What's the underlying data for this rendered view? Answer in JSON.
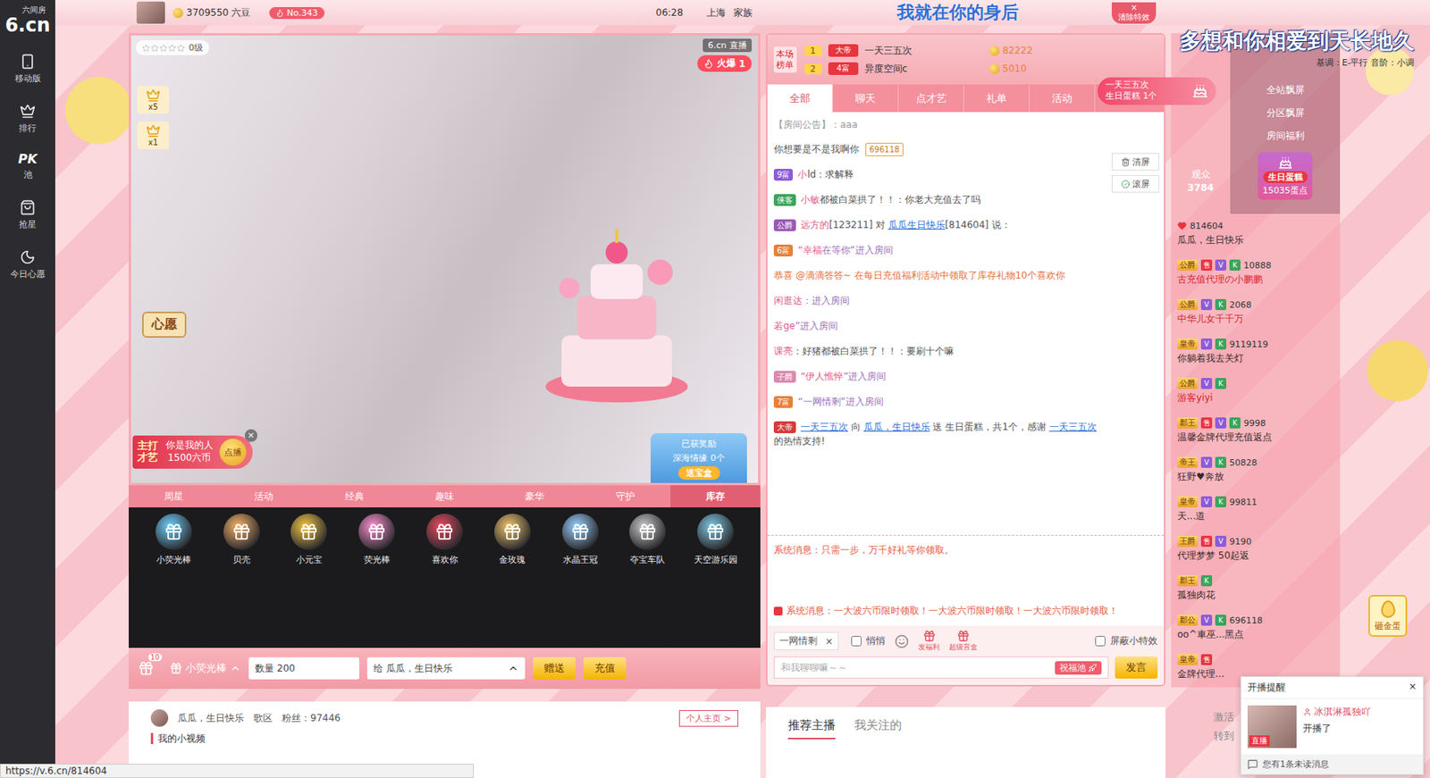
{
  "logo": {
    "mark": "6.cn",
    "name": "六间房"
  },
  "sidebar": [
    {
      "label": "移动版",
      "kind": "icon"
    },
    {
      "label": "排行",
      "kind": "icon"
    },
    {
      "label": "池",
      "mark": "PK",
      "kind": "mark"
    },
    {
      "label": "抢星",
      "kind": "icon"
    },
    {
      "label": "今日心愿",
      "kind": "icon"
    }
  ],
  "topbar": {
    "beans": "3709550 六豆",
    "rank": "No.343",
    "time": "06:28",
    "city": "上海",
    "family": "家族",
    "marquee": "我就在你的身后",
    "clear": "清除特效",
    "clearIcon": "×"
  },
  "banner": {
    "title": "多想和你相爱到天长地久",
    "sub": "基调：E-平行  音阶：小调"
  },
  "video": {
    "stars": 0,
    "level": "0级",
    "badges": [
      {
        "count": "x5"
      },
      {
        "count": "x1"
      }
    ],
    "brand": "6.cn",
    "live": "直播",
    "hot": "火爆",
    "hotCount": "1",
    "wish": "心愿",
    "song": {
      "tag": "主打才艺",
      "title": "你是我的人",
      "price": "1500六币",
      "button": "点播",
      "close": "×"
    },
    "activity": [
      "已获奖励",
      "深海情缘 0个",
      "送宝盒"
    ]
  },
  "giftTabs": [
    {
      "label": "周星",
      "selected": false
    },
    {
      "label": "活动",
      "selected": false
    },
    {
      "label": "经典",
      "selected": false
    },
    {
      "label": "趣味",
      "selected": false
    },
    {
      "label": "豪华",
      "selected": false
    },
    {
      "label": "守护",
      "selected": false
    },
    {
      "label": "库存",
      "selected": true
    }
  ],
  "gifts": [
    "小荧光棒",
    "贝壳",
    "小元宝",
    "荧光棒",
    "喜欢你",
    "金玫瑰",
    "水晶王冠",
    "夺宝车队",
    "天空游乐园"
  ],
  "sendBar": {
    "count": "10",
    "gift": "小荧光棒",
    "qty": "数量 200",
    "to": "给 瓜瓜，生日快乐",
    "send": "赠送",
    "recharge": "充值"
  },
  "profile": {
    "name": "瓜瓜，生日快乐",
    "zone": "歌区",
    "fans": "粉丝：97446",
    "home": "个人主页 >",
    "videos": "我的小视频"
  },
  "rank": {
    "label": "本场榜单",
    "rows": [
      {
        "rank": "1",
        "badge": "大帝",
        "name": "一天三五次",
        "score": "82222"
      },
      {
        "rank": "2",
        "badge": "4富",
        "name": "异度空间c",
        "score": "5010"
      }
    ]
  },
  "chatTabs": [
    {
      "label": "全部",
      "selected": true
    },
    {
      "label": "聊天",
      "selected": false
    },
    {
      "label": "点才艺",
      "selected": false
    },
    {
      "label": "礼单",
      "selected": false
    },
    {
      "label": "活动",
      "selected": false
    }
  ],
  "chatTools": [
    "清屏",
    "滚屏"
  ],
  "announcement": "【房间公告】：aaa",
  "messages": [
    {
      "badge": "",
      "color": "#999999",
      "tag": "696118",
      "parts": [
        {
          "text": "你想要是不是我啊你",
          "tone": "plain"
        }
      ]
    },
    {
      "badge": "9富",
      "color": "#8e5bd8",
      "tag": "",
      "parts": [
        {
          "text": "小",
          "tone": "user"
        },
        {
          "text": "ld：求解释",
          "tone": "plain"
        }
      ]
    },
    {
      "badge": "侠客",
      "color": "#3aa55a",
      "tag": "",
      "parts": [
        {
          "text": "小敏",
          "tone": "user"
        },
        {
          "text": "都被白菜拱了！！：你老大充值去了吗",
          "tone": "plain"
        }
      ]
    },
    {
      "badge": "公爵",
      "color": "#9b59b6",
      "tag": "",
      "parts": [
        {
          "text": "远方的",
          "tone": "user"
        },
        {
          "text": "[123211] 对 ",
          "tone": "plain"
        },
        {
          "text": "瓜瓜生日快乐",
          "tone": "link"
        },
        {
          "text": "[814604] 说：",
          "tone": "plain"
        }
      ]
    },
    {
      "badge": "6富",
      "color": "#e8803a",
      "tag": "",
      "parts": [
        {
          "text": "“幸福",
          "tone": "user"
        },
        {
          "text": "在等你”进入房间",
          "tone": "enter"
        }
      ]
    },
    {
      "badge": "",
      "color": "#999999",
      "tag": "",
      "parts": [
        {
          "text": "恭喜 @滴滴答答~ 在每日充值福利活动中领取了库存礼物10个喜欢你",
          "tone": "notice"
        }
      ]
    },
    {
      "badge": "",
      "color": "#999999",
      "tag": "",
      "parts": [
        {
          "text": "闲逛达",
          "tone": "user"
        },
        {
          "text": "：进入房间",
          "tone": "enter"
        }
      ]
    },
    {
      "badge": "",
      "color": "#999999",
      "tag": "",
      "parts": [
        {
          "text": "若ge",
          "tone": "user"
        },
        {
          "text": "”进入房间",
          "tone": "enter"
        }
      ]
    },
    {
      "badge": "",
      "color": "#999999",
      "tag": "",
      "parts": [
        {
          "text": "课亮",
          "tone": "user"
        },
        {
          "text": "：好猪都被白菜拱了！！：要刷十个嘛",
          "tone": "plain"
        }
      ]
    },
    {
      "badge": "子爵",
      "color": "#d98ab0",
      "tag": "",
      "parts": [
        {
          "text": "“伊人憔悴",
          "tone": "user"
        },
        {
          "text": "”进入房间",
          "tone": "enter"
        }
      ]
    },
    {
      "badge": "7富",
      "color": "#e8803a",
      "tag": "",
      "parts": [
        {
          "text": "“一网情剩”进入房间",
          "tone": "enter"
        }
      ]
    },
    {
      "badge": "大帝",
      "color": "#d63a3a",
      "tag": "",
      "parts": [
        {
          "text": "一天三五次",
          "tone": "link"
        },
        {
          "text": " 向 ",
          "tone": "plain"
        },
        {
          "text": "瓜瓜，生日快乐",
          "tone": "link"
        },
        {
          "text": " 送 生日蛋糕，共1个，感谢 ",
          "tone": "plain"
        },
        {
          "text": "一天三五次",
          "tone": "link"
        },
        {
          "text": " 的热情支持!",
          "tone": "plain"
        }
      ]
    }
  ],
  "systemMessages": [
    "系统消息：只需一步，万千好礼等你领取。",
    "系统消息：一大波六币限时领取！一大波六币限时领取！一大波六币限时领取！"
  ],
  "input": {
    "target": "一网情剩",
    "targetClose": "×",
    "whisper": {
      "label": "悄悄",
      "checked": false
    },
    "tools": [
      "发福利",
      "超级盲盒"
    ],
    "mute": {
      "label": "屏蔽小特效",
      "checked": false
    },
    "placeholder": "和我聊聊嘛～～",
    "wish": "祝福池",
    "send": "发言"
  },
  "audience": {
    "label": "观众",
    "count": "3784",
    "users": [
      {
        "role": "",
        "marks": [],
        "id": "814604",
        "name": "瓜瓜，生日快乐",
        "color": "#3a2a2a"
      },
      {
        "role": "公爵",
        "marks": [
          "售",
          "V",
          "K"
        ],
        "id": "10888",
        "name": "古充值代理の小鹏鹏",
        "color": "#d8232a"
      },
      {
        "role": "公爵",
        "marks": [
          "V",
          "K"
        ],
        "id": "2068",
        "name": "中华儿女千千万",
        "color": "#d8232a"
      },
      {
        "role": "皇帝",
        "marks": [
          "V",
          "K"
        ],
        "id": "9119119",
        "name": "你躺着我去关灯",
        "color": "#3a2a2a"
      },
      {
        "role": "公爵",
        "marks": [
          "V",
          "K"
        ],
        "id": "",
        "name": "游客yiyi",
        "color": "#d8232a"
      },
      {
        "role": "郡王",
        "marks": [
          "售",
          "V",
          "K"
        ],
        "id": "9998",
        "name": "温馨金牌代理充值返点",
        "color": "#3a2a2a"
      },
      {
        "role": "帝王",
        "marks": [
          "V",
          "K"
        ],
        "id": "50828",
        "name": "狂野♥奔放",
        "color": "#3a2a2a"
      },
      {
        "role": "皇帝",
        "marks": [
          "V",
          "K"
        ],
        "id": "99811",
        "name": "天...道",
        "color": "#3a2a2a"
      },
      {
        "role": "王爵",
        "marks": [
          "售",
          "V"
        ],
        "id": "9190",
        "name": "代理梦梦 50起返",
        "color": "#3a2a2a"
      },
      {
        "role": "郡王",
        "marks": [
          "K"
        ],
        "id": "",
        "name": "孤独肉花",
        "color": "#3a2a2a"
      },
      {
        "role": "郡公",
        "marks": [
          "V",
          "K"
        ],
        "id": "696118",
        "name": "oo^車巫...黑点",
        "color": "#3a2a2a"
      },
      {
        "role": "皇帝",
        "marks": [
          "售"
        ],
        "id": "",
        "name": "金牌代理...",
        "color": "#3a2a2a"
      }
    ]
  },
  "sidePanel": {
    "buttons": [
      "全站飘屏",
      "分区飘屏",
      "房间福利"
    ],
    "cake": {
      "title": "生日蛋糕",
      "points": "15035蛋点"
    }
  },
  "floatGift": {
    "user": "一天三五次",
    "gift": "生日蛋糕 1个"
  },
  "egg": "砸金蛋",
  "recommendTabs": [
    {
      "label": "推荐主播",
      "selected": true
    },
    {
      "label": "我关注的",
      "selected": false
    }
  ],
  "notice": {
    "title": "开播提醒",
    "close": "×",
    "user": "冰淇淋孤独吖",
    "text": "开播了",
    "live": "直播",
    "footer": "您有1条未读消息"
  },
  "watermark": [
    "激活",
    "转到"
  ],
  "statusUrl": "https://v.6.cn/814604"
}
